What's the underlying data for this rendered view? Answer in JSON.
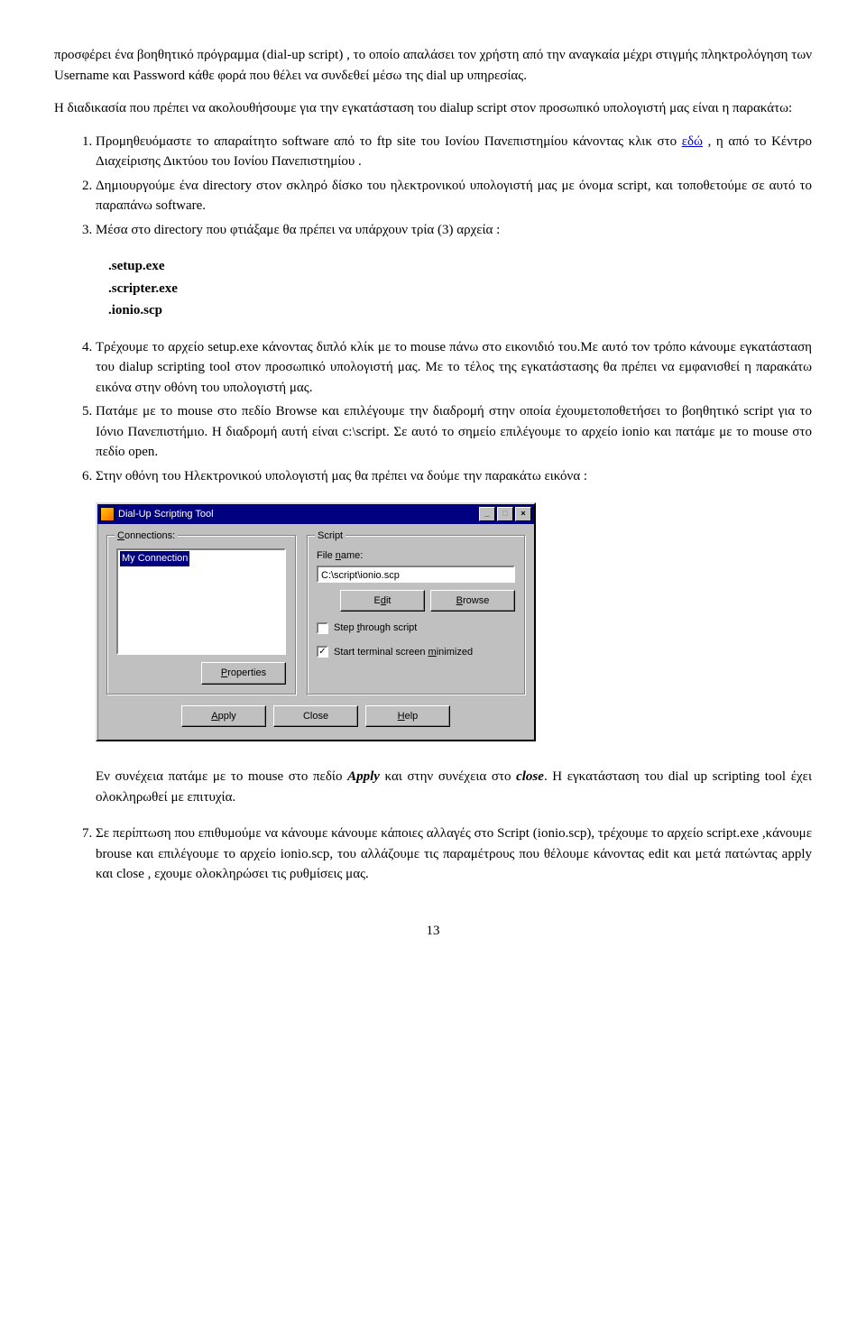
{
  "intro": {
    "p1": "προσφέρει ένα βοηθητικό πρόγραμμα (dial-up script) , το οποίο απαλάσει τον χρήστη από την αναγκαία μέχρι στιγμής πληκτρολόγηση των Username και Password κάθε φορά που θέλει να συνδεθεί μέσω της dial up υπηρεσίας.",
    "p2": "Η διαδικασία που πρέπει να ακολουθήσουμε για την εγκατάσταση του dialup script στον προσωπικό υπολογιστή μας είναι η παρακάτω:"
  },
  "list1": {
    "i1a": "Προμηθευόμαστε το απαραίτητο software από το ftp site του Ιονίου Πανεπιστημίου κάνοντας κλικ στο ",
    "i1_link": "εδώ",
    "i1b": " , η από το Κέντρο Διαχείρισης Δικτύου του Ιονίου Πανεπιστημίου .",
    "i2": "Δημιουργούμε ένα directory στον σκληρό δίσκο του ηλεκτρονικού υπολογιστή μας με όνομα script, και τοποθετούμε σε αυτό το παραπάνω software.",
    "i3": "Μέσα στο directory που φτιάξαμε θα πρέπει να υπάρχουν τρία (3) αρχεία :"
  },
  "files": {
    "f1": ".setup.exe",
    "f2": ".scripter.exe",
    "f3": ".ionio.scp"
  },
  "list2": {
    "i4": "Τρέχουμε το αρχείο setup.exe κάνοντας διπλό κλίκ με το mouse πάνω στο εικονιδιό του.Με αυτό τον τρόπο κάνουμε εγκατάσταση του dialup scripting tool στον προσωπικό υπολογιστή μας. Με το τέλος της εγκατάστασης θα πρέπει να εμφανισθεί η παρακάτω εικόνα στην οθόνη του υπολογιστή μας.",
    "i5": "Πατάμε με το mouse στο πεδίο Browse και επιλέγουμε την διαδρομή στην οποία έχουμετοποθετήσει το βοηθητικό script για το Ιόνιο Πανεπιστήμιο. Η διαδρομή αυτή είναι c:\\script. Σε αυτό το σημείο επιλέγουμε το αρχείο ionio και πατάμε με το mouse στο πεδίο open.",
    "i6": "Στην οθόνη του Ηλεκτρονικού υπολογιστή μας θα πρέπει να δούμε την παρακάτω εικόνα :"
  },
  "dialog": {
    "title": "Dial-Up Scripting Tool",
    "group_conn": "Connections:",
    "conn_item": "My Connection",
    "btn_properties": "Properties",
    "group_script": "Script",
    "lbl_filename": "File name:",
    "filepath": "C:\\script\\ionio.scp",
    "btn_edit_pre": "E",
    "btn_edit_u": "d",
    "btn_edit_post": "it",
    "btn_browse_pre": "",
    "btn_browse_u": "B",
    "btn_browse_post": "rowse",
    "chk1_pre": "Step ",
    "chk1_u": "t",
    "chk1_post": "hrough script",
    "chk2_pre": "Start terminal screen ",
    "chk2_u": "m",
    "chk2_post": "inimized",
    "btn_apply_u": "A",
    "btn_apply_post": "pply",
    "btn_close": "Close",
    "btn_help_u": "H",
    "btn_help_post": "elp"
  },
  "after": {
    "p1a": "Εν συνέχεια πατάμε με το mouse στο πεδίο ",
    "p1_apply": "Apply",
    "p1b": " και στην συνέχεια στο ",
    "p1_close": "close",
    "p1c": ". Η εγκατάσταση του dial up scripting tool έχει ολοκληρωθεί με επιτυχία."
  },
  "list3": {
    "i7": "Σε περίπτωση που επιθυμούμε να κάνουμε κάνουμε κάποιες αλλαγές στο Script (ionio.scp), τρέχουμε το αρχείο script.exe ,κάνουμε brouse και επιλέγουμε το αρχείο ionio.scp, του αλλάζουμε τις παραμέτρους που θέλουμε κάνοντας edit και μετά πατώντας apply και close , εχουμε ολοκληρώσει τις ρυθμίσεις μας."
  },
  "page_number": "13"
}
